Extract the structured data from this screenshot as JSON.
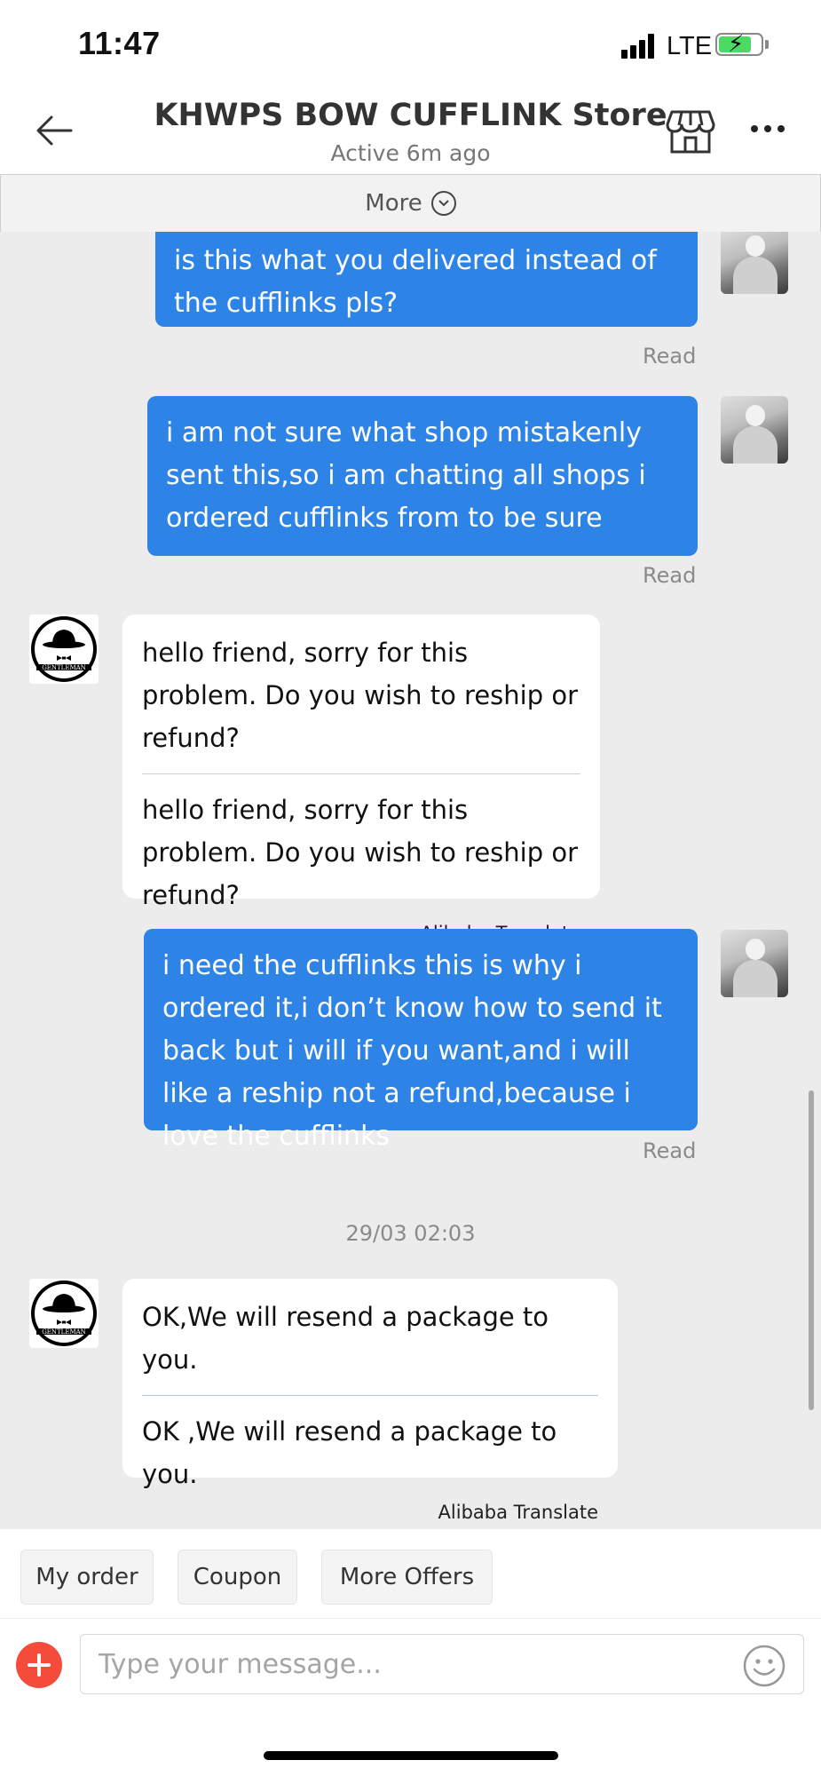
{
  "status_bar": {
    "time": "11:47",
    "network": "LTE"
  },
  "header": {
    "title": "KHWPS BOW CUFFLINK Store",
    "subtitle": "Active 6m ago"
  },
  "more_bar": {
    "label": "More"
  },
  "messages": [
    {
      "text": "is this what you delivered instead of the cufflinks pls?",
      "status": "Read"
    },
    {
      "text": "i am not sure what shop mistakenly sent this,so i am chatting all shops i ordered cufflinks from to be sure",
      "status": "Read"
    },
    {
      "text": "hello friend, sorry for this problem. Do you wish to reship or refund?",
      "translation": "hello friend, sorry for this problem. Do you wish to reship or refund?",
      "translate_label": "Alibaba Translate"
    },
    {
      "text": "i need the cufflinks this is why i ordered it,i don’t know how to send it back but i will if you want,and i will like a reship not a refund,because i love the cufflinks",
      "status": "Read"
    },
    {
      "date": "29/03 02:03"
    },
    {
      "text": "OK,We will resend a package to you.",
      "translation": "OK ,We will resend a package to you.",
      "translate_label": "Alibaba Translate"
    }
  ],
  "quick_replies": [
    "My order",
    "Coupon",
    "More Offers"
  ],
  "input": {
    "placeholder": "Type your message..."
  },
  "store_logo": {
    "text": "GENTLEMAN"
  },
  "colors": {
    "outgoing_bubble": "#2d83e6",
    "add_button": "#f44b3a",
    "chat_bg": "#ececec"
  }
}
